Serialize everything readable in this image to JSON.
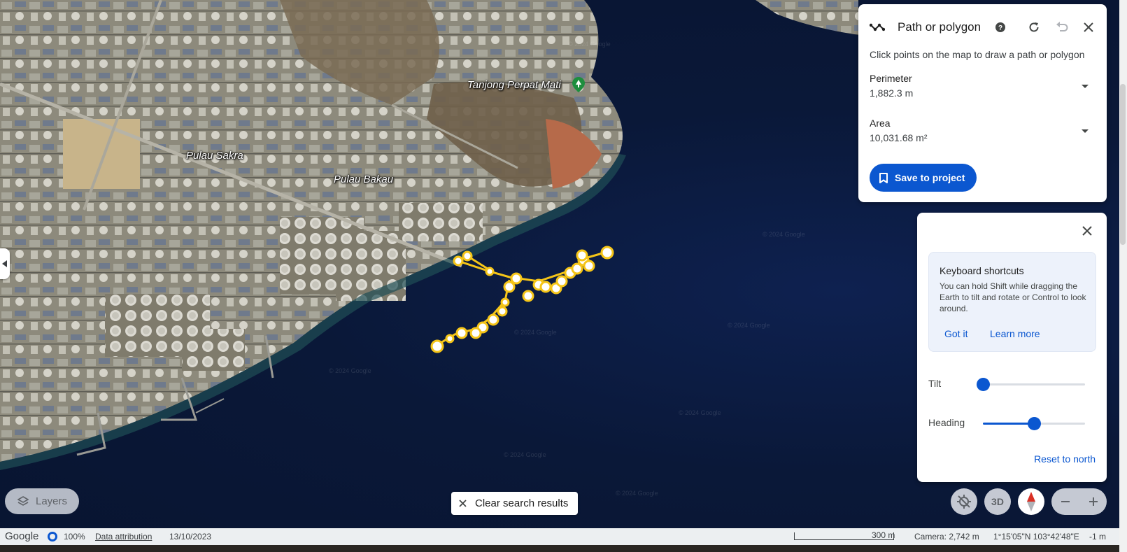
{
  "map": {
    "labels": {
      "tanjong": "Tanjong Perpat Mati",
      "pulau_sakra": "Pulau Sakra",
      "pulau_bakau": "Pulau Bakau"
    },
    "watermark": "© 2024 Google",
    "accent_path_color": "#f5c518"
  },
  "path_panel": {
    "title": "Path or polygon",
    "instruction": "Click points on the map to draw a path or polygon",
    "perimeter": {
      "label": "Perimeter",
      "value": "1,882.3 m"
    },
    "area": {
      "label": "Area",
      "value": "10,031.68 m²"
    },
    "save_label": "Save to project",
    "icons": [
      "path-polygon-icon",
      "help-icon",
      "redo-icon",
      "undo-icon",
      "close-icon"
    ]
  },
  "view_panel": {
    "shortcuts": {
      "title": "Keyboard shortcuts",
      "description": "You can hold Shift while dragging the Earth to tilt and rotate or Control to look around.",
      "got_it": "Got it",
      "learn_more": "Learn more"
    },
    "tilt": {
      "label": "Tilt",
      "level": 0.0
    },
    "heading": {
      "label": "Heading",
      "level": 0.5
    },
    "reset_label": "Reset to north"
  },
  "controls": {
    "layers_label": "Layers",
    "clear_label": "Clear search results",
    "three_d_label": "3D"
  },
  "status": {
    "brand": "Google",
    "loaded": "100%",
    "attribution": "Data attribution",
    "date": "13/10/2023",
    "scale": "300 m",
    "camera": "Camera: 2,742 m",
    "coords": "1°15'05\"N 103°42'48\"E",
    "elevation": "-1 m"
  },
  "colors": {
    "accent": "#0b57d0",
    "panel_bg": "#ffffff",
    "card_bg": "#edf2fb"
  }
}
